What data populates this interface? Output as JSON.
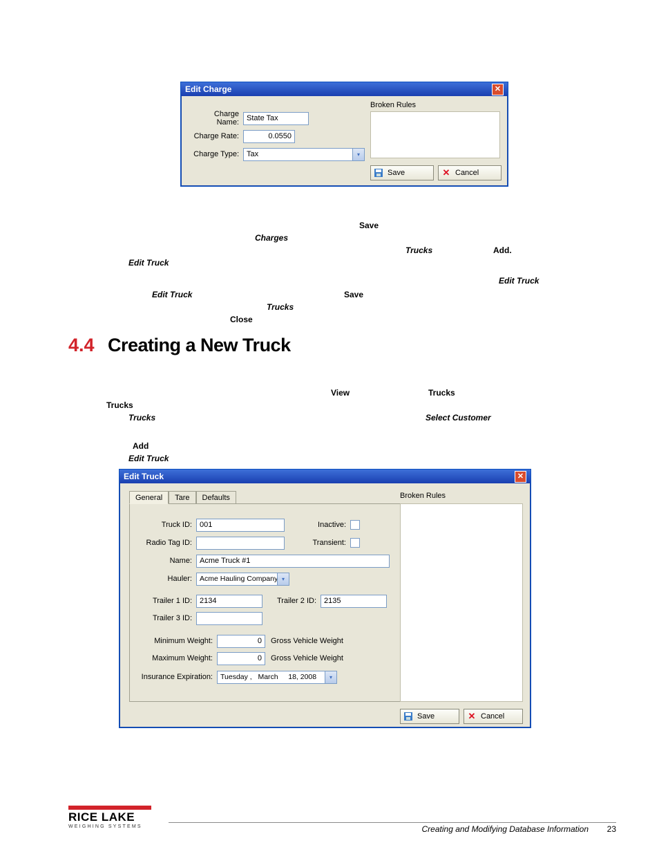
{
  "edit_charge": {
    "title": "Edit Charge",
    "charge_name_label": "Charge Name:",
    "charge_name_value": "State Tax",
    "charge_rate_label": "Charge Rate:",
    "charge_rate_value": "0.0550",
    "charge_type_label": "Charge Type:",
    "charge_type_value": "Tax",
    "broken_rules_label": "Broken Rules",
    "save_label": "Save",
    "cancel_label": "Cancel"
  },
  "midtext": {
    "save1": "Save",
    "charges": "Charges",
    "trucks": "Trucks",
    "add": "Add.",
    "edit_truck": "Edit Truck",
    "edit_truck2": "Edit Truck",
    "edit_truck3": "Edit Truck",
    "save2": "Save",
    "trucks2": "Trucks",
    "close": "Close"
  },
  "section": {
    "num": "4.4",
    "title": "Creating a New Truck"
  },
  "steps": {
    "view": "View",
    "trucks": "Trucks",
    "trucks_bolditalic": "Trucks",
    "select_customer": "Select Customer",
    "add": "Add",
    "edit_truck": "Edit Truck"
  },
  "edit_truck": {
    "title": "Edit Truck",
    "tabs": {
      "general": "General",
      "tare": "Tare",
      "defaults": "Defaults"
    },
    "truck_id_label": "Truck ID:",
    "truck_id_value": "001",
    "inactive_label": "Inactive:",
    "radio_tag_label": "Radio Tag ID:",
    "transient_label": "Transient:",
    "name_label": "Name:",
    "name_value": "Acme Truck #1",
    "hauler_label": "Hauler:",
    "hauler_value": "Acme Hauling Company",
    "trailer1_label": "Trailer 1 ID:",
    "trailer1_value": "2134",
    "trailer2_label": "Trailer 2 ID:",
    "trailer2_value": "2135",
    "trailer3_label": "Trailer 3 ID:",
    "min_weight_label": "Minimum Weight:",
    "min_weight_value": "0",
    "gvw1": "Gross Vehicle Weight",
    "max_weight_label": "Maximum Weight:",
    "max_weight_value": "0",
    "gvw2": "Gross Vehicle Weight",
    "ins_exp_label": "Insurance Expiration:",
    "ins_exp_value": "Tuesday ,   March     18, 2008",
    "broken_rules_label": "Broken Rules",
    "save_label": "Save",
    "cancel_label": "Cancel"
  },
  "footer": {
    "text": "Creating and Modifying Database Information",
    "page": "23",
    "brand": "RICE LAKE",
    "brand_sub": "WEIGHING SYSTEMS"
  }
}
